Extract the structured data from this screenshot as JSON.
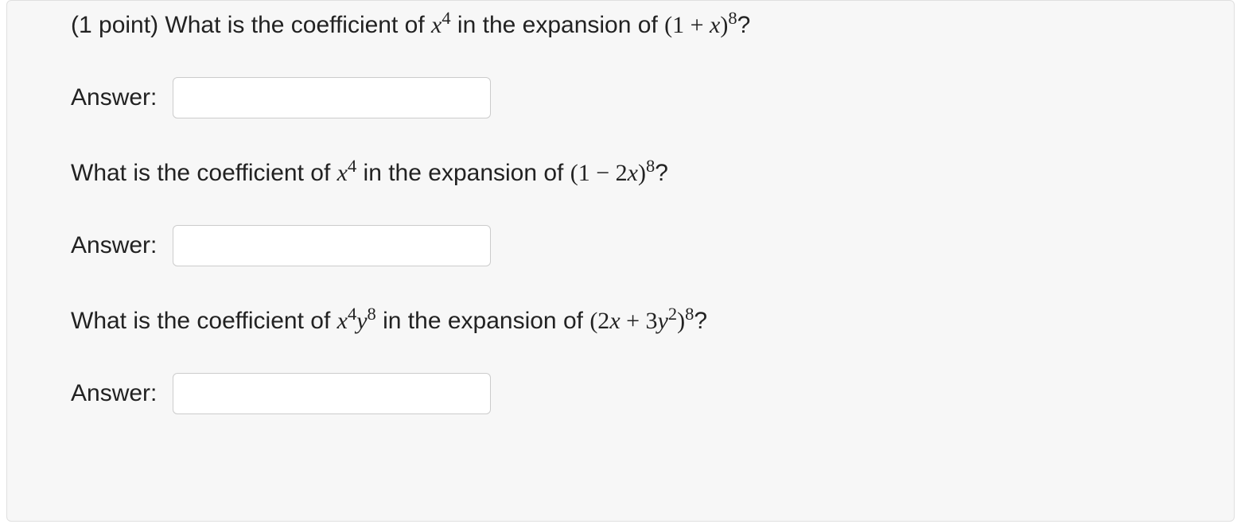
{
  "points_prefix": "(1 point) ",
  "q1": {
    "prefix": "What is the coefficient of ",
    "term_base": "x",
    "term_exp": "4",
    "middle": " in the expansion of ",
    "expr_open": "(1 + ",
    "expr_var": "x",
    "expr_close": ")",
    "expr_exp": "8",
    "suffix": "?"
  },
  "q2": {
    "prefix": "What is the coefficient of ",
    "term_base": "x",
    "term_exp": "4",
    "middle": " in the expansion of ",
    "expr_open": "(1 − 2",
    "expr_var": "x",
    "expr_close": ")",
    "expr_exp": "8",
    "suffix": "?"
  },
  "q3": {
    "prefix": "What is the coefficient of ",
    "term_base1": "x",
    "term_exp1": "4",
    "term_base2": "y",
    "term_exp2": "8",
    "middle": " in the expansion of ",
    "expr_open": "(2",
    "expr_var1": "x",
    "expr_plus": " + 3",
    "expr_var2": "y",
    "expr_var2_exp": "2",
    "expr_close": ")",
    "expr_exp": "8",
    "suffix": "?"
  },
  "answer_label": "Answer:",
  "answers": {
    "a1": "",
    "a2": "",
    "a3": ""
  }
}
